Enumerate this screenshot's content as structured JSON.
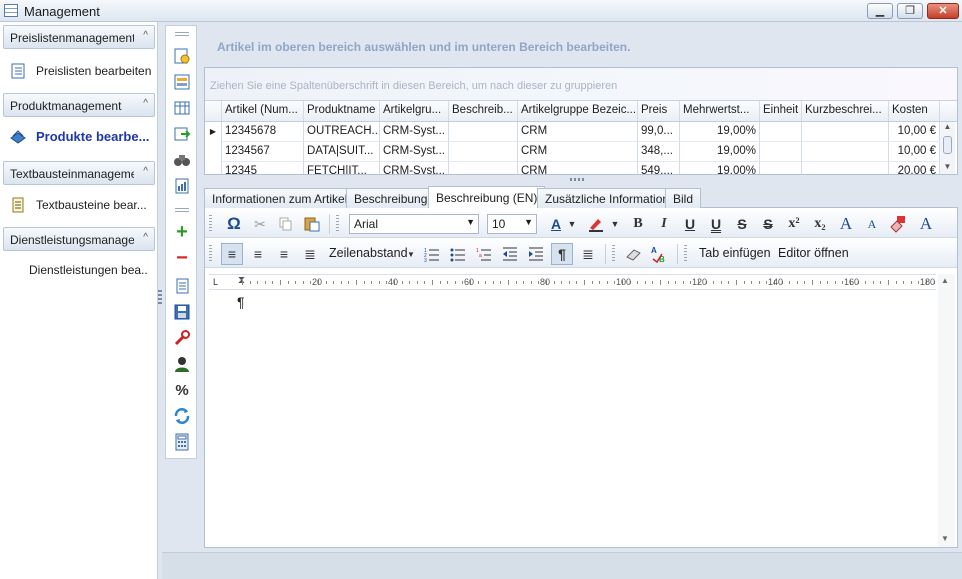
{
  "window": {
    "title": "Management",
    "minimize": "▁",
    "maximize": "❐",
    "close": "✕"
  },
  "sidebar": {
    "groups": [
      {
        "header": "Preislistenmanagement",
        "item": "Preislisten bearbeiten",
        "item_icon": "list-icon"
      },
      {
        "header": "Produktmanagement",
        "item": "Produkte bearbe...",
        "item_icon": "products-icon"
      },
      {
        "header": "Textbausteinmanagement",
        "item": "Textbausteine bear...",
        "item_icon": "document-icon"
      },
      {
        "header": "Dienstleistungsmanagement",
        "item": "Dienstleistungen bea...",
        "item_icon": ""
      }
    ],
    "chevron": "^"
  },
  "instruction": "Artikel im oberen bereich auswählen und im unteren Bereich bearbeiten.",
  "grid": {
    "group_hint": "Ziehen Sie eine Spaltenüberschrift in diesen Bereich, um nach dieser zu gruppieren",
    "columns": [
      "Artikel (Num...",
      "Produktname",
      "Artikelgru...",
      "Beschreib...",
      "Artikelgruppe Bezeic...",
      "Preis",
      "Mehrwertst...",
      "Einheit",
      "Kurzbeschrei...",
      "Kosten"
    ],
    "rows": [
      {
        "indicator": "▶",
        "cells": [
          "12345678",
          "OUTREACH...",
          "CRM-Syst...",
          "",
          "CRM",
          "99,0...",
          "19,00%",
          "",
          "",
          "10,00 €"
        ]
      },
      {
        "indicator": "",
        "cells": [
          "1234567",
          "DATA|SUIT...",
          "CRM-Syst...",
          "",
          "CRM",
          "348,...",
          "19,00%",
          "",
          "",
          "10,00 €"
        ]
      },
      {
        "indicator": "",
        "cells": [
          "12345",
          "FETCH|IT...",
          "CRM-Syst...",
          "",
          "CRM",
          "549,...",
          "19,00%",
          "",
          "",
          "20,00 €"
        ]
      }
    ]
  },
  "tabs": [
    "Informationen zum Artikel",
    "Beschreibung",
    "Beschreibung (EN)",
    "Zusätzliche Information",
    "Bild"
  ],
  "active_tab": "Beschreibung (EN)",
  "editor": {
    "font_name": "Arial",
    "font_size": "10",
    "line_spacing_label": "Zeilenabstand",
    "insert_tab_label": "Tab einfügen",
    "open_editor_label": "Editor öffnen",
    "ruler_corner": "L",
    "ruler_labels": [
      "20",
      "40",
      "60",
      "80",
      "100",
      "120",
      "140",
      "160",
      "180"
    ],
    "paragraph_mark": "¶"
  }
}
